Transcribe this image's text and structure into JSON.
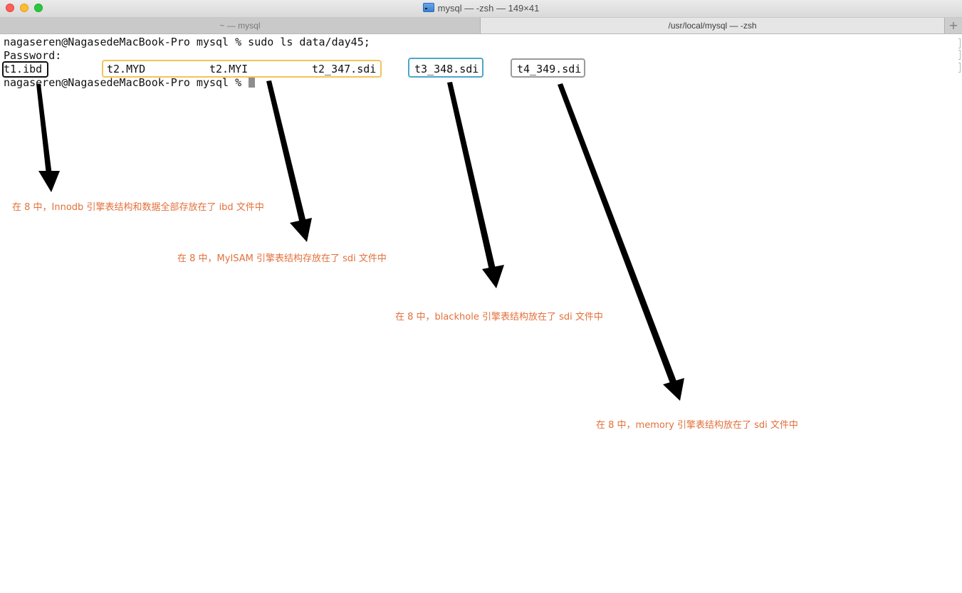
{
  "window": {
    "title": "mysql — -zsh — 149×41",
    "title_icon": "terminal-folder-icon"
  },
  "tabs": [
    {
      "label": "~ — mysql",
      "active": false
    },
    {
      "label": "/usr/local/mysql — -zsh",
      "active": true
    }
  ],
  "new_tab_label": "+",
  "terminal": {
    "lines": [
      "nagaseren@NagasedeMacBook-Pro mysql % sudo ls data/day45;",
      "Password:"
    ],
    "prompt": "nagaseren@NagasedeMacBook-Pro mysql % ",
    "files": {
      "t1_ibd": "t1.ibd",
      "t2_myd": "t2.MYD",
      "t2_myi": "t2.MYI",
      "t2_sdi": "t2_347.sdi",
      "t3_sdi": "t3_348.sdi",
      "t4_sdi": "t4_349.sdi"
    }
  },
  "annotations": {
    "innodb": "在 8 中，Innodb 引擎表结构和数据全部存放在了 ibd 文件中",
    "myisam": "在 8 中，MyISAM 引擎表结构存放在了 sdi 文件中",
    "blackhole": "在 8 中，blackhole 引擎表结构放在了 sdi 文件中",
    "memory": "在 8 中，memory 引擎表结构放在了 sdi 文件中"
  },
  "colors": {
    "annotation_text": "#e2703a",
    "box_innodb": "#111111",
    "box_myisam": "#f2c45a",
    "box_blackhole": "#4ea6c9",
    "box_memory": "#9a9a9a",
    "arrow": "#000000"
  }
}
